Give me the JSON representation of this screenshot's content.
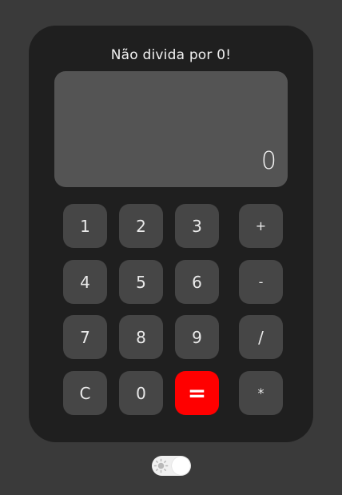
{
  "calculator": {
    "title": "Não divida por 0!",
    "display_value": "0",
    "keys": {
      "k1": "1",
      "k2": "2",
      "k3": "3",
      "plus": "+",
      "k4": "4",
      "k5": "5",
      "k6": "6",
      "minus": "-",
      "k7": "7",
      "k8": "8",
      "k9": "9",
      "divide": "/",
      "clear": "C",
      "k0": "0",
      "equals": "=",
      "multiply": "*"
    }
  },
  "theme_toggle": {
    "icon": "sun-icon",
    "state": "on"
  },
  "colors": {
    "background": "#3a3a3a",
    "panel": "#1f1f1f",
    "display": "#545454",
    "key": "#464646",
    "equals_accent": "#ff0000"
  }
}
